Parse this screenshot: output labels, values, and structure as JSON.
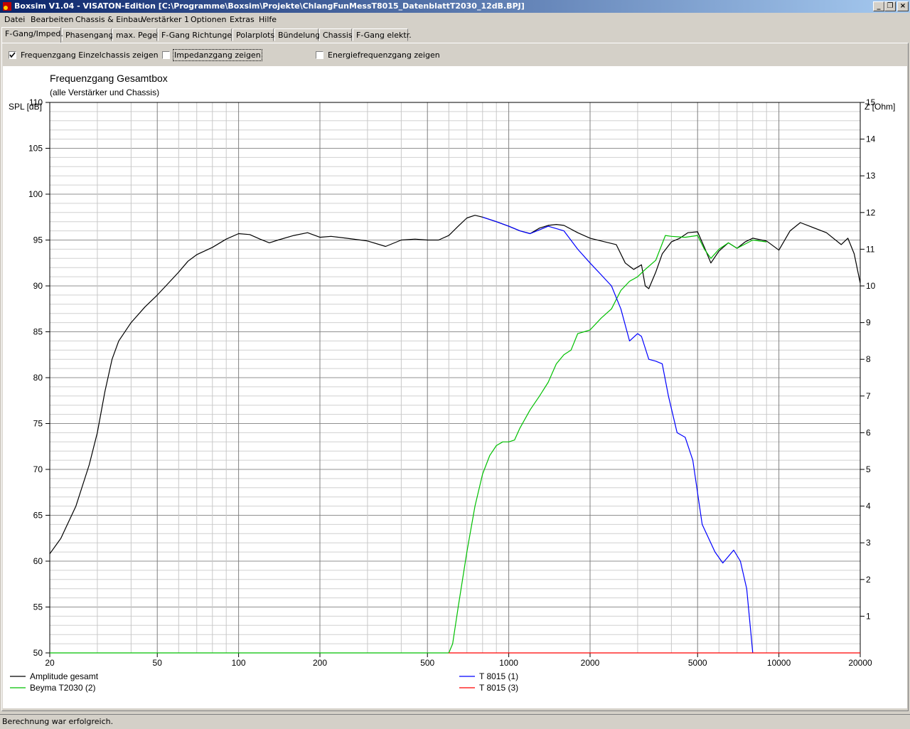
{
  "window": {
    "title": "Boxsim V1.04 - VISATON-Edition [C:\\Programme\\Boxsim\\Projekte\\ChlangFunMessT8015_DatenblattT2030_12dB.BPJ]",
    "controls": [
      "_",
      "❐",
      "×"
    ]
  },
  "menu": [
    "Datei",
    "Bearbeiten",
    "Chassis & Einbau",
    "Verstärker 1",
    "Optionen",
    "Extras",
    "Hilfe"
  ],
  "tabs": [
    {
      "label": "F-Gang/Imped.",
      "active": true
    },
    {
      "label": "Phasengang",
      "active": false
    },
    {
      "label": "max. Pegel",
      "active": false
    },
    {
      "label": "F-Gang Richtungen",
      "active": false
    },
    {
      "label": "Polarplots",
      "active": false
    },
    {
      "label": "Bündelung",
      "active": false
    },
    {
      "label": "Chassis",
      "active": false
    },
    {
      "label": "F-Gang elektr.",
      "active": false
    }
  ],
  "options": [
    {
      "label": "Frequenzgang Einzelchassis zeigen",
      "checked": true
    },
    {
      "label": "Impedanzgang zeigen",
      "checked": false
    },
    {
      "label": "Energiefrequenzgang zeigen",
      "checked": false
    }
  ],
  "status": "Berechnung war erfolgreich.",
  "chart_data": {
    "type": "line",
    "title": "Frequenzgang Gesamtbox",
    "subtitle": "(alle Verstärker und Chassis)",
    "ylabel": "SPL [dB]",
    "y2label": "Z [Ohm]",
    "xscale": "log",
    "xlim": [
      20,
      20000
    ],
    "ylim": [
      50,
      110
    ],
    "y2lim": [
      0,
      15
    ],
    "xticks": [
      20,
      50,
      100,
      200,
      500,
      1000,
      2000,
      5000,
      10000,
      20000
    ],
    "yticks": [
      50,
      55,
      60,
      65,
      70,
      75,
      80,
      85,
      90,
      95,
      100,
      105,
      110
    ],
    "y2ticks": [
      1,
      2,
      3,
      4,
      5,
      6,
      7,
      8,
      9,
      10,
      11,
      12,
      13,
      14,
      15
    ],
    "grid": true,
    "legend_position": "bottom",
    "series": [
      {
        "name": "Amplitude gesamt",
        "color": "#000000",
        "points": [
          [
            20,
            60.8
          ],
          [
            22,
            62.5
          ],
          [
            25,
            66
          ],
          [
            28,
            70.5
          ],
          [
            30,
            74
          ],
          [
            32,
            78.5
          ],
          [
            34,
            82
          ],
          [
            36,
            84
          ],
          [
            40,
            86
          ],
          [
            45,
            87.7
          ],
          [
            50,
            89
          ],
          [
            55,
            90.3
          ],
          [
            60,
            91.5
          ],
          [
            65,
            92.7
          ],
          [
            70,
            93.4
          ],
          [
            80,
            94.2
          ],
          [
            90,
            95.1
          ],
          [
            100,
            95.7
          ],
          [
            110,
            95.6
          ],
          [
            120,
            95.1
          ],
          [
            130,
            94.7
          ],
          [
            140,
            95
          ],
          [
            160,
            95.5
          ],
          [
            180,
            95.8
          ],
          [
            200,
            95.3
          ],
          [
            220,
            95.4
          ],
          [
            250,
            95.2
          ],
          [
            300,
            94.9
          ],
          [
            350,
            94.3
          ],
          [
            400,
            95
          ],
          [
            450,
            95.1
          ],
          [
            500,
            95
          ],
          [
            550,
            95
          ],
          [
            600,
            95.5
          ],
          [
            650,
            96.5
          ],
          [
            700,
            97.4
          ],
          [
            750,
            97.7
          ],
          [
            800,
            97.5
          ],
          [
            900,
            97
          ],
          [
            1000,
            96.5
          ],
          [
            1100,
            96
          ],
          [
            1200,
            95.7
          ],
          [
            1300,
            96.3
          ],
          [
            1400,
            96.6
          ],
          [
            1500,
            96.7
          ],
          [
            1600,
            96.6
          ],
          [
            1800,
            95.8
          ],
          [
            2000,
            95.2
          ],
          [
            2200,
            94.9
          ],
          [
            2500,
            94.5
          ],
          [
            2700,
            92.5
          ],
          [
            2900,
            91.8
          ],
          [
            3100,
            92.3
          ],
          [
            3200,
            90
          ],
          [
            3300,
            89.7
          ],
          [
            3500,
            91.5
          ],
          [
            3700,
            93.5
          ],
          [
            4000,
            94.8
          ],
          [
            4300,
            95.2
          ],
          [
            4600,
            95.8
          ],
          [
            5000,
            95.9
          ],
          [
            5300,
            94.2
          ],
          [
            5600,
            92.5
          ],
          [
            6000,
            93.8
          ],
          [
            6500,
            94.7
          ],
          [
            7000,
            94.1
          ],
          [
            7500,
            94.8
          ],
          [
            8000,
            95.2
          ],
          [
            9000,
            94.9
          ],
          [
            10000,
            93.9
          ],
          [
            11000,
            96
          ],
          [
            12000,
            96.9
          ],
          [
            13000,
            96.5
          ],
          [
            15000,
            95.8
          ],
          [
            17000,
            94.5
          ],
          [
            18000,
            95.2
          ],
          [
            19000,
            93.5
          ],
          [
            20000,
            90.3
          ]
        ]
      },
      {
        "name": "Beyma T2030 (2)",
        "color": "#00c000",
        "points": [
          [
            20,
            50
          ],
          [
            500,
            50
          ],
          [
            600,
            50
          ],
          [
            620,
            51
          ],
          [
            650,
            55
          ],
          [
            700,
            61
          ],
          [
            750,
            66
          ],
          [
            800,
            69.5
          ],
          [
            850,
            71.5
          ],
          [
            900,
            72.6
          ],
          [
            950,
            73
          ],
          [
            1000,
            73
          ],
          [
            1050,
            73.2
          ],
          [
            1100,
            74.5
          ],
          [
            1200,
            76.5
          ],
          [
            1300,
            78
          ],
          [
            1400,
            79.5
          ],
          [
            1500,
            81.5
          ],
          [
            1600,
            82.5
          ],
          [
            1700,
            83
          ],
          [
            1800,
            84.8
          ],
          [
            1900,
            85
          ],
          [
            2000,
            85.2
          ],
          [
            2200,
            86.5
          ],
          [
            2400,
            87.5
          ],
          [
            2600,
            89.5
          ],
          [
            2800,
            90.5
          ],
          [
            3000,
            91
          ],
          [
            3200,
            91.8
          ],
          [
            3500,
            92.8
          ],
          [
            3800,
            95.5
          ],
          [
            4000,
            95.4
          ],
          [
            4500,
            95.3
          ],
          [
            5000,
            95.5
          ],
          [
            5300,
            94
          ],
          [
            5600,
            93
          ],
          [
            6000,
            94
          ],
          [
            6500,
            94.7
          ],
          [
            7000,
            94.1
          ],
          [
            8000,
            95
          ],
          [
            9000,
            94.8
          ]
        ]
      },
      {
        "name": "T 8015 (1)",
        "color": "#0000ff",
        "points": [
          [
            800,
            97.5
          ],
          [
            900,
            97
          ],
          [
            1000,
            96.5
          ],
          [
            1100,
            96
          ],
          [
            1200,
            95.7
          ],
          [
            1400,
            96.5
          ],
          [
            1600,
            96
          ],
          [
            1800,
            94
          ],
          [
            2000,
            92.5
          ],
          [
            2200,
            91.2
          ],
          [
            2400,
            90
          ],
          [
            2600,
            87.5
          ],
          [
            2800,
            84
          ],
          [
            3000,
            84.8
          ],
          [
            3100,
            84.5
          ],
          [
            3300,
            82
          ],
          [
            3500,
            81.8
          ],
          [
            3700,
            81.5
          ],
          [
            3900,
            78
          ],
          [
            4200,
            74
          ],
          [
            4500,
            73.5
          ],
          [
            4800,
            71
          ],
          [
            5200,
            64
          ],
          [
            5800,
            61
          ],
          [
            6200,
            59.8
          ],
          [
            6800,
            61.2
          ],
          [
            7200,
            60
          ],
          [
            7600,
            57
          ],
          [
            8000,
            50
          ]
        ]
      },
      {
        "name": "T 8015 (3)",
        "color": "#ff0000",
        "points": [
          [
            600,
            50
          ],
          [
            20000,
            50
          ]
        ]
      }
    ]
  }
}
